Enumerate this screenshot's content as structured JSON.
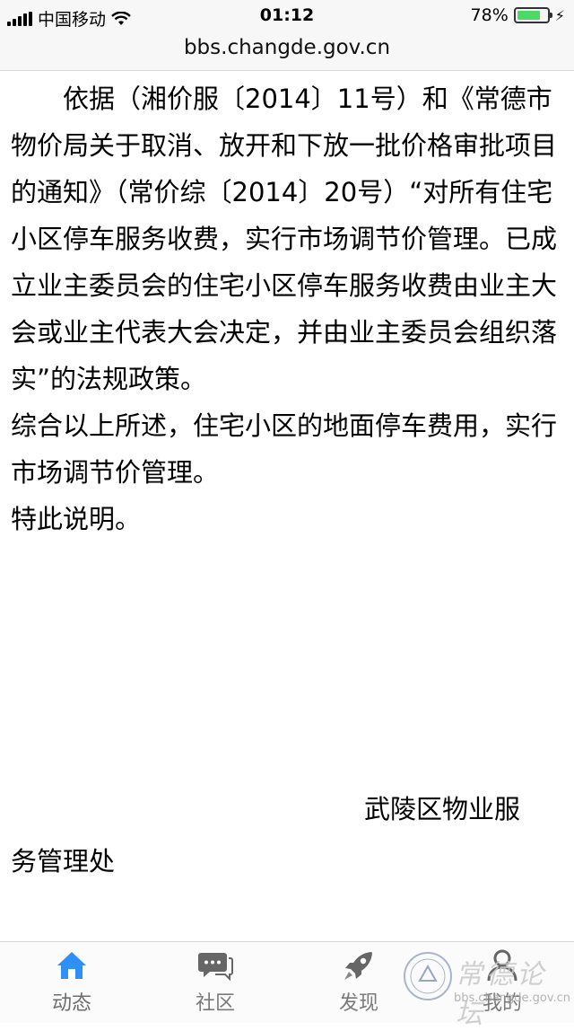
{
  "status": {
    "carrier": "中国移动",
    "time": "01:12",
    "battery_percent": "78%",
    "battery_level": 0.78,
    "battery_color": "#4cd964"
  },
  "url": "bbs.changde.gov.cn",
  "article": {
    "paragraphs": [
      "依据（湘价服〔2014〕11号）和《常德市物价局关于取消、放开和下放一批价格审批项目的通知》（常价综〔2014〕20号）“对所有住宅小区停车服务收费，实行市场调节价管理。已成立业主委员会的住宅小区停车服务收费由业主大会或业主代表大会决定，并由业主委员会组织落实”的法规政策。",
      "综合以上所述，住宅小区的地面停车费用，实行市场调节价管理。",
      "特此说明。"
    ],
    "signature_line1": "武陵区物业服",
    "signature_line2": "务管理处"
  },
  "tabs": [
    {
      "label": "动态",
      "icon": "home-icon",
      "active": true,
      "color": "#2f8ff5"
    },
    {
      "label": "社区",
      "icon": "chat-icon",
      "active": false
    },
    {
      "label": "发现",
      "icon": "rocket-icon",
      "active": false
    },
    {
      "label": "我的",
      "icon": "user-icon",
      "active": false
    }
  ],
  "watermark": {
    "text": "常德论坛",
    "url": "bbs.changde.gov.cn"
  }
}
